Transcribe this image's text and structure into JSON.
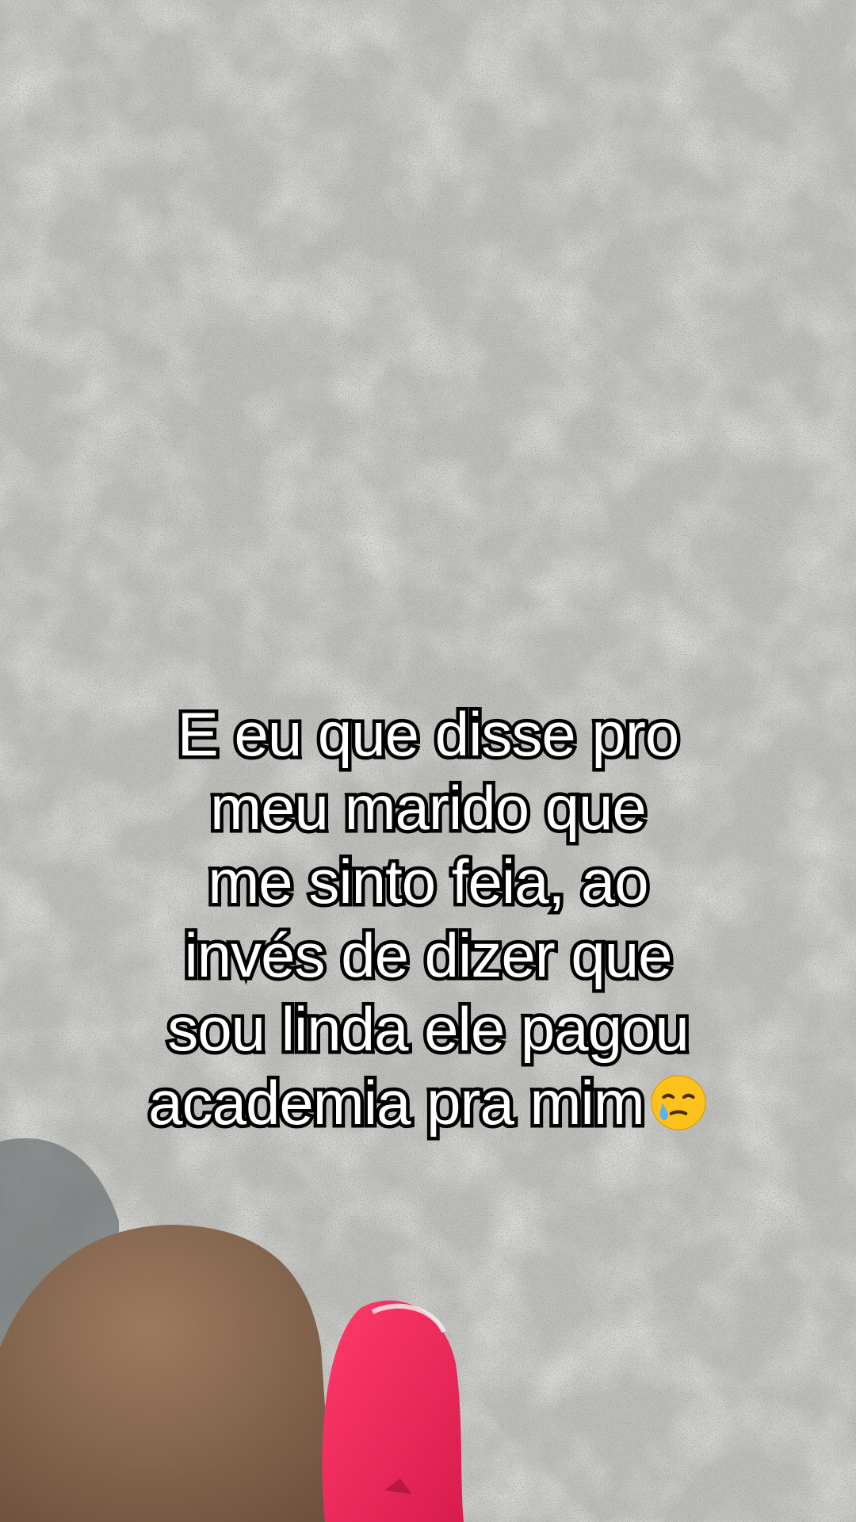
{
  "scene": {
    "description_icon": "concrete-floor-with-leg-and-pink-sneaker",
    "colors": {
      "concrete": "#b9b8b4",
      "concrete_dark": "#4f5a5c",
      "shadow": "#6f7475",
      "skin": "#8a6a52",
      "sneaker": "#f0285a"
    }
  },
  "caption": {
    "lines": [
      "E eu que disse pro",
      "meu marido que",
      "me sinto feia, ao",
      "invés de dizer que",
      "sou linda ele pagou",
      "academia pra mim"
    ],
    "emoji_icon": "face-holding-back-tears-icon"
  }
}
